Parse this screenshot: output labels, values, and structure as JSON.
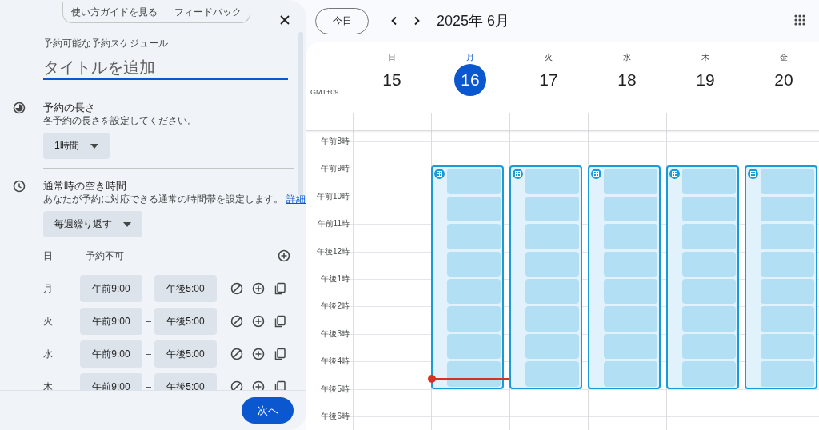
{
  "panel": {
    "tabs": [
      {
        "label": "使い方ガイドを見る"
      },
      {
        "label": "フィードバック"
      }
    ],
    "eyebrow": "予約可能な予約スケジュール",
    "title_field": {
      "placeholder": "タイトルを追加"
    },
    "sections": [
      {
        "kind": "duration",
        "title": "予約の長さ",
        "description": "各予約の長さを設定してください。",
        "dropdown": "1時間"
      },
      {
        "kind": "hours",
        "title": "通常時の空き時間",
        "description": "あなたが予約に対応できる通常の時間帯を設定します。",
        "link": "詳細",
        "dropdown": "毎週繰り返す"
      }
    ],
    "days": [
      {
        "day": "日",
        "available": false,
        "note": "予約不可"
      },
      {
        "day": "月",
        "available": true,
        "start": "午前9:00",
        "separator": "–",
        "end": "午後5:00"
      },
      {
        "day": "火",
        "available": true,
        "start": "午前9:00",
        "separator": "–",
        "end": "午後5:00"
      },
      {
        "day": "水",
        "available": true,
        "start": "午前9:00",
        "separator": "–",
        "end": "午後5:00"
      },
      {
        "day": "木",
        "available": true,
        "start": "午前9:00",
        "separator": "–",
        "end": "午後5:00"
      }
    ],
    "next_button": "次へ"
  },
  "calendar": {
    "today_button": "今日",
    "title": "2025年 6月",
    "timezone": "GMT+09",
    "days": [
      {
        "weekday": "日",
        "date": "15",
        "selected": false,
        "has_block": false
      },
      {
        "weekday": "月",
        "date": "16",
        "selected": true,
        "has_block": true
      },
      {
        "weekday": "火",
        "date": "17",
        "selected": false,
        "has_block": true
      },
      {
        "weekday": "水",
        "date": "18",
        "selected": false,
        "has_block": true
      },
      {
        "weekday": "木",
        "date": "19",
        "selected": false,
        "has_block": true
      },
      {
        "weekday": "金",
        "date": "20",
        "selected": false,
        "has_block": true
      }
    ],
    "hours": [
      "午前8時",
      "午前9時",
      "午前10時",
      "午前11時",
      "午後12時",
      "午後1時",
      "午後2時",
      "午後3時",
      "午後4時",
      "午後5時",
      "午後6時"
    ]
  }
}
